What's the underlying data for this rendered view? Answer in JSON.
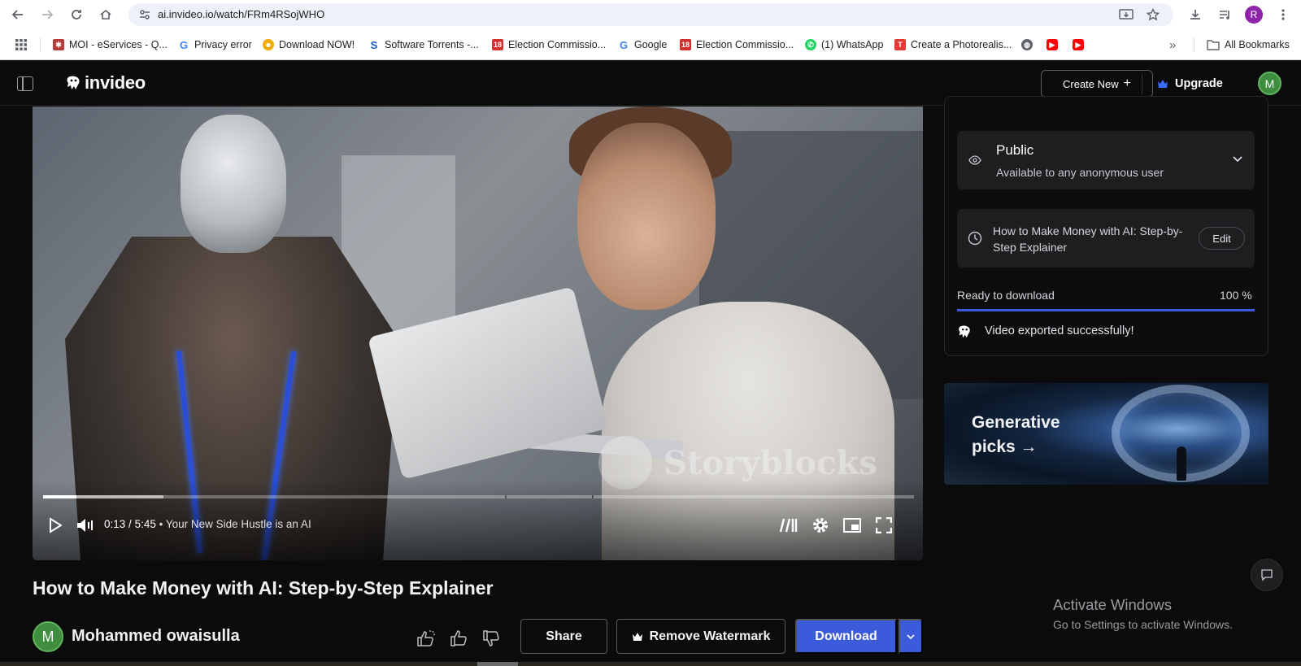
{
  "browser": {
    "url": "ai.invideo.io/watch/FRm4RSojWHO",
    "profile_initial": "R",
    "bookmarks": [
      {
        "label": "MOI - eServices - Q...",
        "icon": "moi-icon",
        "color": "#b33b3b"
      },
      {
        "label": "Privacy error",
        "icon": "google-icon",
        "color": "#4285f4"
      },
      {
        "label": "Download NOW!",
        "icon": "download-now-icon",
        "color": "#f2a900"
      },
      {
        "label": "Software Torrents -...",
        "icon": "software-torrents-icon",
        "color": "#1a56c4"
      },
      {
        "label": "Election Commissio...",
        "icon": "election-icon",
        "color": "#d32f2f"
      },
      {
        "label": "Google",
        "icon": "google-icon",
        "color": "#4285f4"
      },
      {
        "label": "Election Commissio...",
        "icon": "election-icon",
        "color": "#d32f2f"
      },
      {
        "label": "(1) WhatsApp",
        "icon": "whatsapp-icon",
        "color": "#25d366"
      },
      {
        "label": "Create a Photorealis...",
        "icon": "t-icon",
        "color": "#e53935"
      }
    ],
    "all_bookmarks_label": "All Bookmarks"
  },
  "header": {
    "logo_text": "invideo",
    "create_new_label": "Create New",
    "upgrade_label": "Upgrade",
    "avatar_initial": "M"
  },
  "player": {
    "current_time": "0:13",
    "duration": "5:45",
    "chapter": "Your New Side Hustle is an AI",
    "watermark": "Storyblocks",
    "played_fraction": 0.038,
    "buffered_fraction": 0.138,
    "chapter_breaks": [
      0.53,
      0.63
    ]
  },
  "right_panel": {
    "visibility_title": "Public",
    "visibility_subtitle": "Available to any anonymous user",
    "video_title": "How to Make Money with AI: Step-by-Step Explainer",
    "edit_label": "Edit",
    "ready_label": "Ready to download",
    "ready_percent": "100 %",
    "ready_fraction": 1.0,
    "export_message": "Video exported successfully!",
    "banner_line1": "Generative",
    "banner_line2": "picks →"
  },
  "video_info": {
    "title": "How to Make Money with AI: Step-by-Step Explainer",
    "author_initial": "M",
    "author_name": "Mohammed owaisulla",
    "share_label": "Share",
    "remove_watermark_label": "Remove Watermark",
    "download_label": "Download"
  },
  "os_overlay": {
    "activate_title": "Activate Windows",
    "activate_sub": "Go to Settings to activate Windows."
  },
  "colors": {
    "accent": "#3b5bdb",
    "background": "#0b0b0c",
    "panel": "#1e1e21"
  }
}
